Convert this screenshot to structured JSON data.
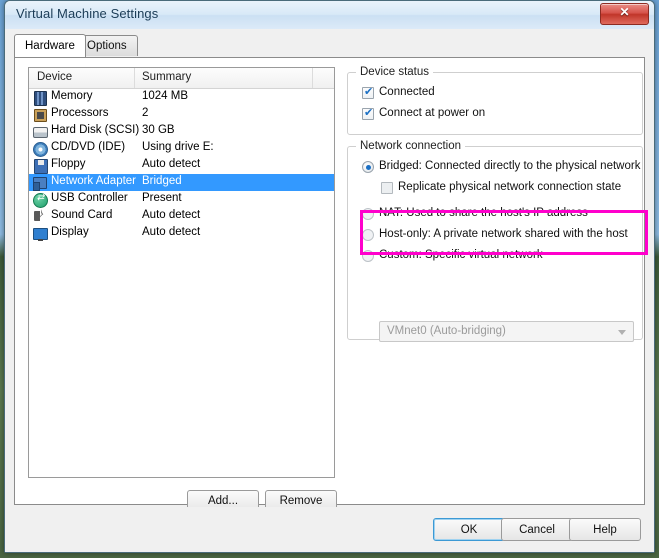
{
  "window": {
    "title": "Virtual Machine Settings",
    "close_label": "Close"
  },
  "tabs": [
    {
      "label": "Hardware",
      "active": true
    },
    {
      "label": "Options",
      "active": false
    }
  ],
  "device_list": {
    "columns": [
      "Device",
      "Summary"
    ],
    "rows": [
      {
        "icon": "memory-icon",
        "name": "Memory",
        "summary": "1024 MB",
        "selected": false
      },
      {
        "icon": "processor-icon",
        "name": "Processors",
        "summary": "2",
        "selected": false
      },
      {
        "icon": "hard-disk-icon",
        "name": "Hard Disk (SCSI)",
        "summary": "30 GB",
        "selected": false
      },
      {
        "icon": "cd-dvd-icon",
        "name": "CD/DVD (IDE)",
        "summary": "Using drive E:",
        "selected": false
      },
      {
        "icon": "floppy-icon",
        "name": "Floppy",
        "summary": "Auto detect",
        "selected": false
      },
      {
        "icon": "network-adapter-icon",
        "name": "Network Adapter",
        "summary": "Bridged",
        "selected": true
      },
      {
        "icon": "usb-controller-icon",
        "name": "USB Controller",
        "summary": "Present",
        "selected": false
      },
      {
        "icon": "sound-card-icon",
        "name": "Sound Card",
        "summary": "Auto detect",
        "selected": false
      },
      {
        "icon": "display-icon",
        "name": "Display",
        "summary": "Auto detect",
        "selected": false
      }
    ],
    "add_label": "Add...",
    "remove_label": "Remove"
  },
  "device_status": {
    "legend": "Device status",
    "checkboxes": [
      {
        "label": "Connected",
        "checked": true
      },
      {
        "label": "Connect at power on",
        "checked": true
      }
    ]
  },
  "network_connection": {
    "legend": "Network connection",
    "options": [
      {
        "label": "Bridged: Connected directly to the physical network",
        "selected": true
      },
      {
        "label": "NAT: Used to share the host's IP address",
        "selected": false
      },
      {
        "label": "Host-only: A private network shared with the host",
        "selected": false
      },
      {
        "label": "Custom: Specific virtual network",
        "selected": false
      }
    ],
    "replicate": {
      "label": "Replicate physical network connection state",
      "checked": false
    },
    "custom_network": {
      "value": "VMnet0 (Auto-bridging)",
      "enabled": false
    },
    "highlight_color": "#ff00cc"
  },
  "footer": {
    "ok": "OK",
    "cancel": "Cancel",
    "help": "Help"
  }
}
